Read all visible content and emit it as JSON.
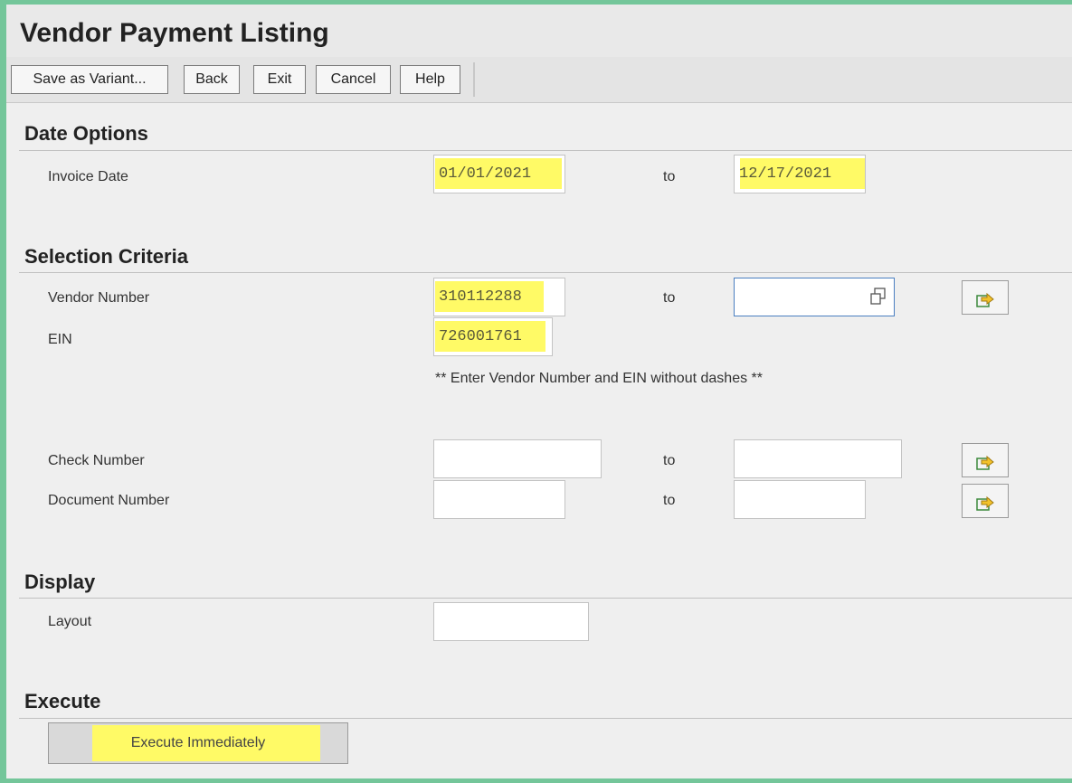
{
  "app": {
    "title": "Vendor Payment Listing"
  },
  "toolbar": {
    "save_variant": "Save as Variant...",
    "back": "Back",
    "exit": "Exit",
    "cancel": "Cancel",
    "help": "Help"
  },
  "date_options": {
    "heading": "Date Options",
    "invoice_date_label": "Invoice Date",
    "from": "01/01/2021",
    "to_label": "to",
    "to": "12/17/2021"
  },
  "selection": {
    "heading": "Selection Criteria",
    "vendor_label": "Vendor Number",
    "vendor_from": "310112288",
    "vendor_to": "",
    "ein_label": "EIN",
    "ein": "726001761",
    "note": "** Enter Vendor Number and EIN without dashes **",
    "check_label": "Check Number",
    "check_from": "",
    "check_to": "",
    "doc_label": "Document Number",
    "doc_from": "",
    "doc_to": "",
    "to_label": "to"
  },
  "display": {
    "heading": "Display",
    "layout_label": "Layout",
    "layout": ""
  },
  "execute": {
    "heading": "Execute",
    "button": "Execute Immediately"
  },
  "colors": {
    "highlight": "#fffa66",
    "frame": "#74c69a",
    "focus_border": "#4a7fc1"
  }
}
